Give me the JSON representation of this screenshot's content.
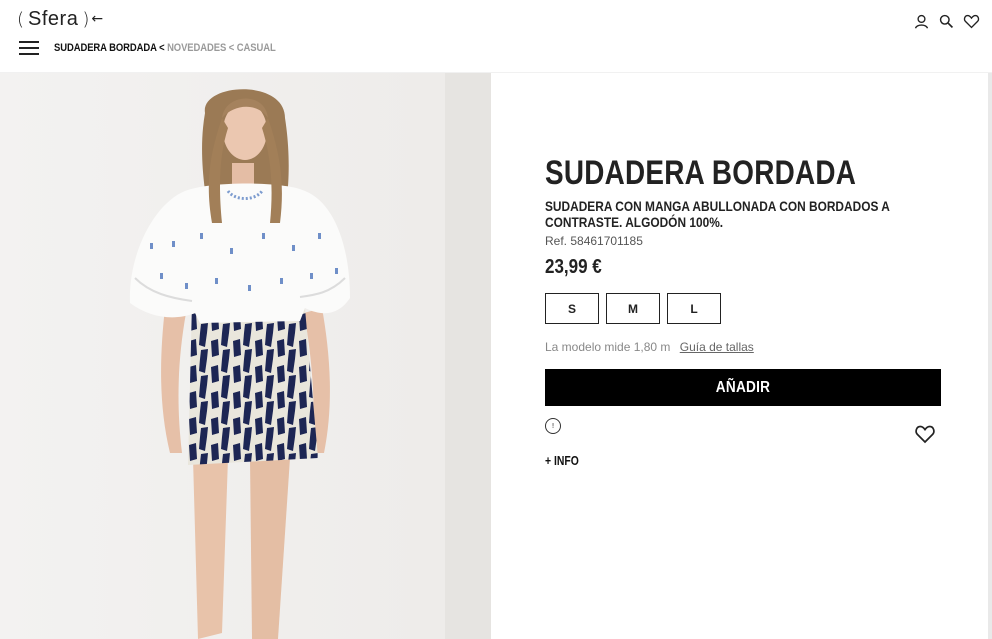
{
  "header": {
    "logo": {
      "paren_open": "(",
      "word": "Sfera",
      "paren_close": ")",
      "back_arrow": "←"
    },
    "breadcrumb": {
      "current": "SUDADERA BORDADA",
      "separator": "<",
      "items": [
        "NOVEDADES",
        "CASUAL"
      ]
    },
    "icons": [
      "user-icon",
      "search-icon",
      "heart-icon"
    ]
  },
  "product": {
    "title": "SUDADERA BORDADA",
    "description": "SUDADERA CON MANGA ABULLONADA CON BORDADOS A CONTRASTE. ALGODÓN 100%.",
    "reference": "Ref. 58461701185",
    "price": "23,99 €",
    "sizes": [
      "S",
      "M",
      "L"
    ],
    "model_info": "La modelo mide 1,80 m",
    "size_guide": "Guía de tallas",
    "add_button": "AÑADIR",
    "info_icon_glyph": "!",
    "more_info": "+ INFO"
  },
  "colors": {
    "text": "#222222",
    "button_bg": "#000000",
    "muted": "#9a9a9a",
    "skirt_navy": "#1d2654"
  }
}
